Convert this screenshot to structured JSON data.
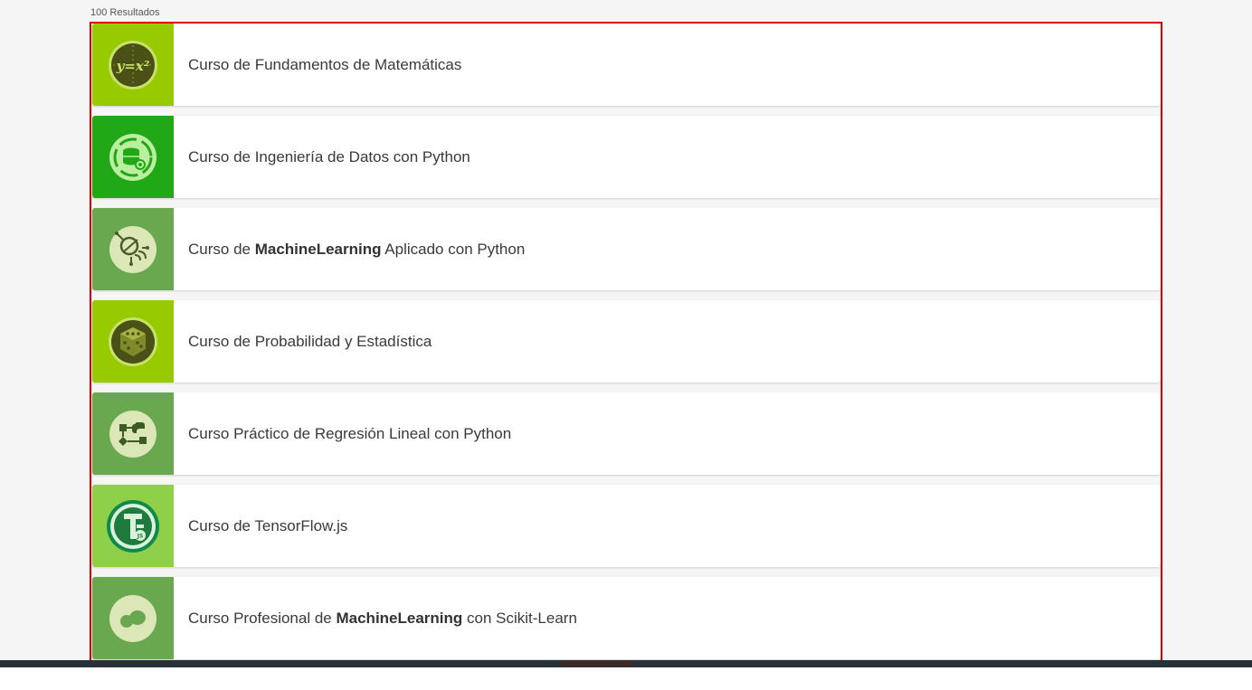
{
  "results": {
    "count_label": "100 Resultados"
  },
  "courses": [
    {
      "prefix": "Curso de Fundamentos de Matemáticas",
      "bold": "",
      "suffix": "",
      "thumb_color": "#98ca00",
      "icon": "math-formula-icon",
      "icon_label": "y=x²"
    },
    {
      "prefix": "Curso de Ingeniería de Datos con Python",
      "bold": "",
      "suffix": "",
      "thumb_color": "#21a817",
      "icon": "database-gear-icon"
    },
    {
      "prefix": "Curso de ",
      "bold": "MachineLearning",
      "suffix": " Aplicado con Python",
      "thumb_color": "#6aa84f",
      "icon": "brain-circuit-icon"
    },
    {
      "prefix": "Curso de Probabilidad y Estadística",
      "bold": "",
      "suffix": "",
      "thumb_color": "#98ca00",
      "icon": "dice-icon"
    },
    {
      "prefix": "Curso Práctico de Regresión Lineal con Python",
      "bold": "",
      "suffix": "",
      "thumb_color": "#6aa84f",
      "icon": "flowchart-python-icon"
    },
    {
      "prefix": "Curso de TensorFlow.js",
      "bold": "",
      "suffix": "",
      "thumb_color": "#8ed04a",
      "icon": "tensorflow-js-icon",
      "icon_label": "JS"
    },
    {
      "prefix": "Curso Profesional de ",
      "bold": "MachineLearning",
      "suffix": " con Scikit-Learn",
      "thumb_color": "#6aa84f",
      "icon": "scikit-learn-icon"
    }
  ],
  "colors": {
    "frame_border": "#e00000",
    "page_bg": "#f5f5f5",
    "card_bg": "#ffffff",
    "footer": "#263238"
  }
}
